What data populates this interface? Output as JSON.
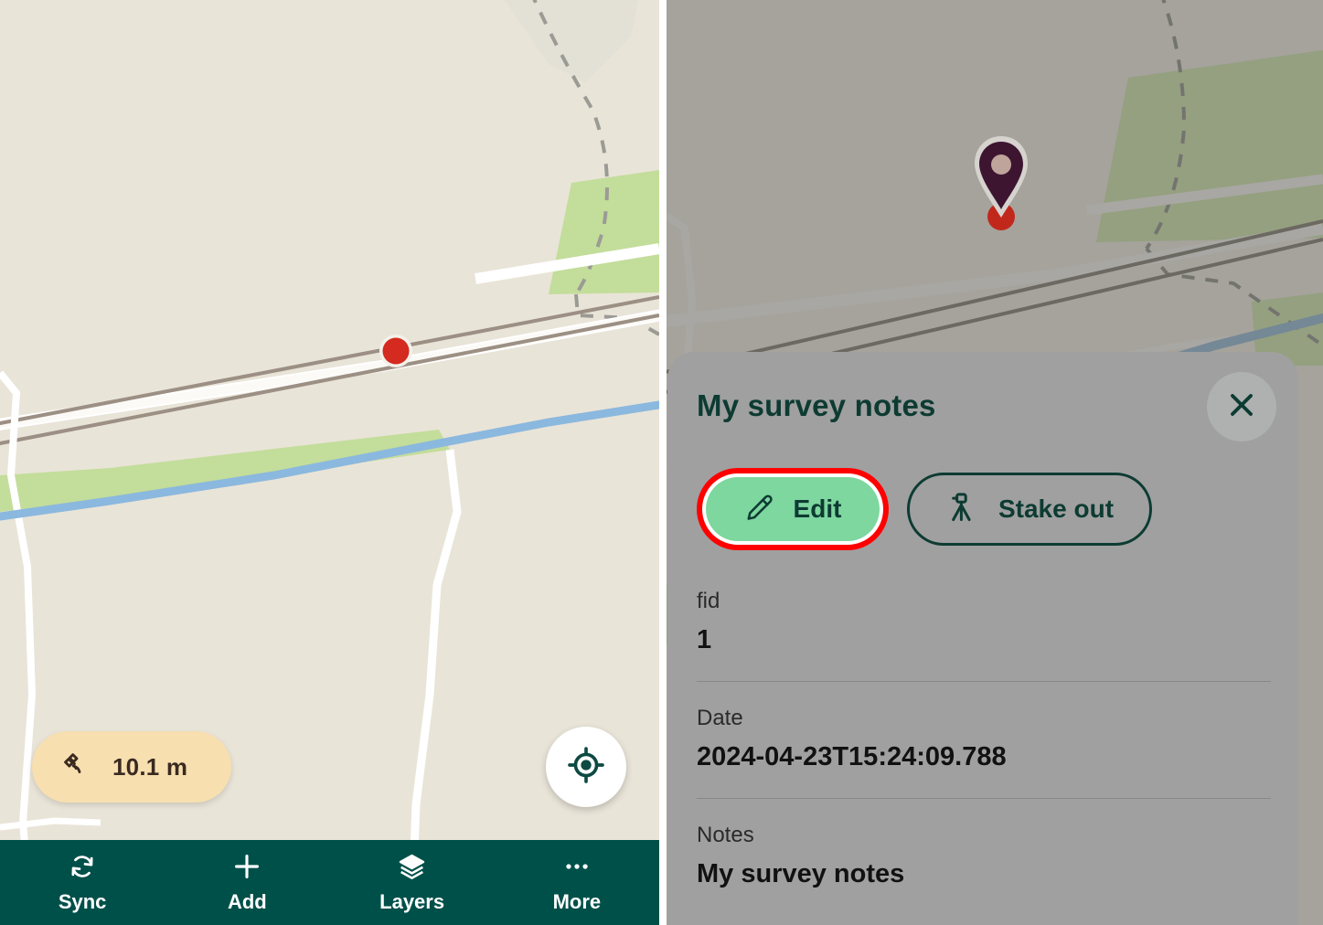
{
  "app": {
    "accent_dark_green": "#0d3b32",
    "nav_bar_color": "#00504a",
    "edit_button_color": "#7dd79f",
    "highlight_ring_color": "#ff0000",
    "sheet_background": "#a0a0a0",
    "gps_badge_color": "#f7dfb0",
    "map_base_color": "#e9e4d8",
    "marker_pin_color": "#3d1530",
    "marker_dot_color": "#d42a1f"
  },
  "left_screen": {
    "gps_badge": {
      "icon": "satellite-icon",
      "accuracy": "10.1 m"
    },
    "locate_button": {
      "icon": "gps-crosshair-icon"
    },
    "map_marker": {
      "icon": "red-point-marker"
    },
    "bottom_nav": {
      "items": [
        {
          "label": "Sync",
          "icon": "sync-icon"
        },
        {
          "label": "Add",
          "icon": "plus-icon"
        },
        {
          "label": "Layers",
          "icon": "layers-icon"
        },
        {
          "label": "More",
          "icon": "ellipsis-icon"
        }
      ]
    }
  },
  "right_screen": {
    "map_pin": {
      "icon": "location-pin-icon"
    },
    "detail_sheet": {
      "title": "My survey notes",
      "close_icon": "close-icon",
      "actions": [
        {
          "label": "Edit",
          "icon": "pencil-icon",
          "highlighted": true
        },
        {
          "label": "Stake out",
          "icon": "tripod-icon",
          "highlighted": false
        }
      ],
      "attributes": [
        {
          "key": "fid",
          "value": "1"
        },
        {
          "key": "Date",
          "value": "2024-04-23T15:24:09.788"
        },
        {
          "key": "Notes",
          "value": "My survey notes"
        }
      ]
    }
  }
}
